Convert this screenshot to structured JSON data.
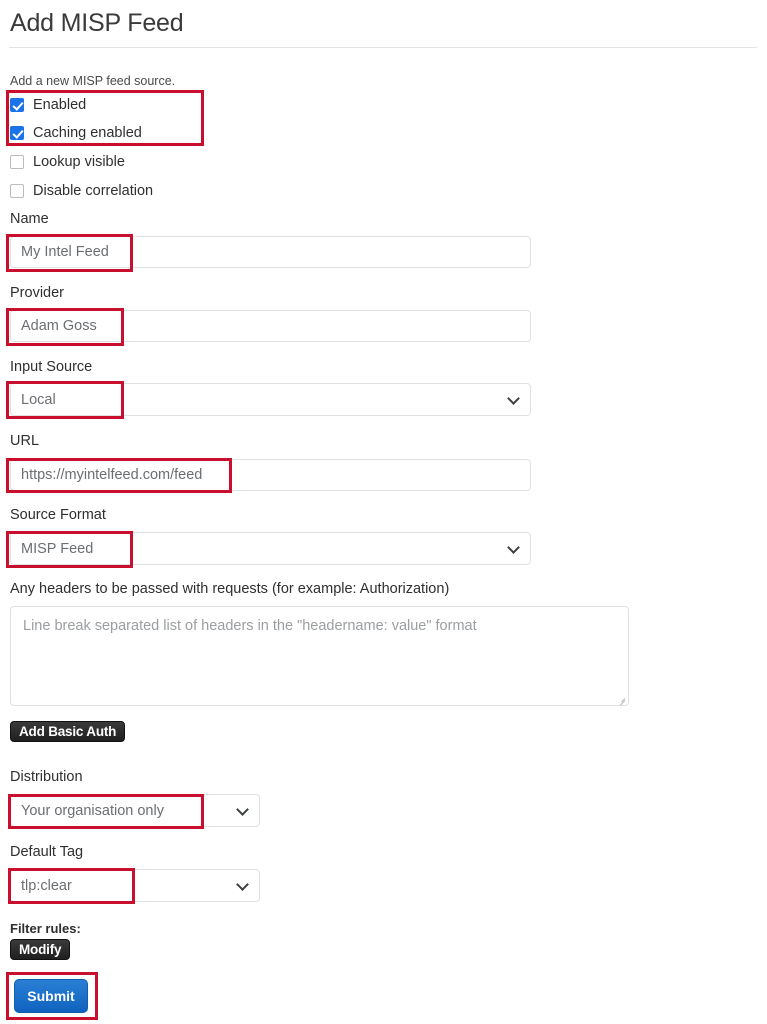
{
  "header": {
    "title": "Add MISP Feed"
  },
  "form": {
    "helper_text": "Add a new MISP feed source.",
    "checkboxes": [
      {
        "label": "Enabled",
        "checked": true
      },
      {
        "label": "Caching enabled",
        "checked": true
      },
      {
        "label": "Lookup visible",
        "checked": false
      },
      {
        "label": "Disable correlation",
        "checked": false
      }
    ],
    "fields": {
      "name": {
        "label": "Name",
        "value": "My Intel Feed"
      },
      "provider": {
        "label": "Provider",
        "value": "Adam Goss"
      },
      "input_source": {
        "label": "Input Source",
        "value": "Local"
      },
      "url": {
        "label": "URL",
        "value": "https://myintelfeed.com/feed"
      },
      "source_format": {
        "label": "Source Format",
        "value": "MISP Feed"
      },
      "headers": {
        "label": "Any headers to be passed with requests (for example: Authorization)",
        "placeholder": "Line break separated list of headers in the \"headername: value\" format",
        "value": ""
      },
      "distribution": {
        "label": "Distribution",
        "value": "Your organisation only"
      },
      "default_tag": {
        "label": "Default Tag",
        "value": "tlp:clear"
      },
      "filter_rules": {
        "label": "Filter rules:"
      }
    },
    "buttons": {
      "add_basic_auth": "Add Basic Auth",
      "modify": "Modify",
      "submit": "Submit"
    }
  },
  "annotation": {
    "color": "#c8102e"
  }
}
